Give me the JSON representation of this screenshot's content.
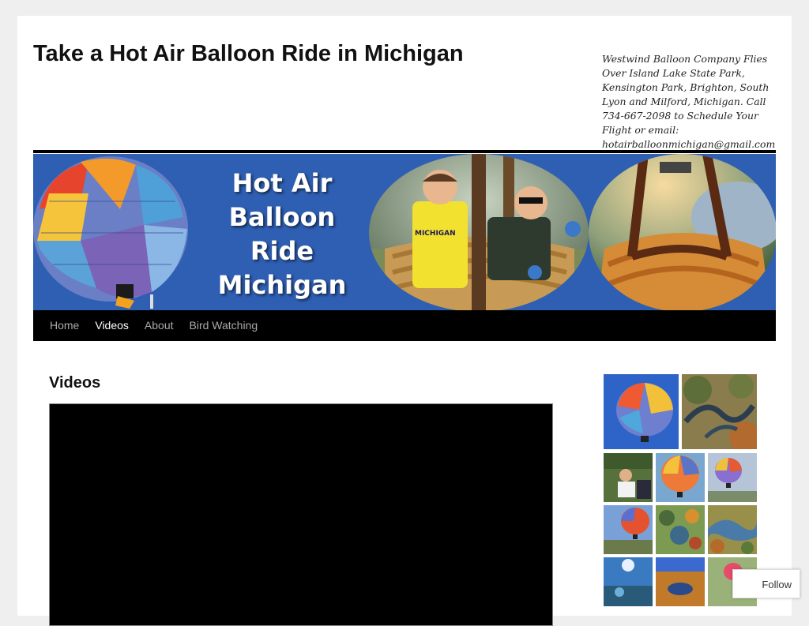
{
  "header": {
    "site_title": "Take a Hot Air Balloon Ride in Michigan",
    "site_description": "Westwind Balloon Company Flies Over Island Lake State Park, Kensington Park, Brighton, South Lyon and Milford, Michigan. Call 734-667-2098 to Schedule Your Flight or email: hotairballoonmichigan@gmail.com"
  },
  "banner": {
    "line1": "Hot Air Balloon",
    "line2": "Ride",
    "line3": "Michigan",
    "shirt_text": "MICHIGAN"
  },
  "nav": {
    "items": [
      {
        "label": "Home"
      },
      {
        "label": "Videos"
      },
      {
        "label": "About"
      },
      {
        "label": "Bird Watching"
      }
    ],
    "current": "Videos"
  },
  "main": {
    "entry_title": "Videos"
  },
  "widget": {
    "follow_label": "Follow"
  },
  "colors": {
    "page_bg": "#efefef",
    "banner_blue": "#2f5fb3",
    "nav_bg": "#000000",
    "nav_current": "#ffffff",
    "nav_text": "#aaaaaa"
  }
}
